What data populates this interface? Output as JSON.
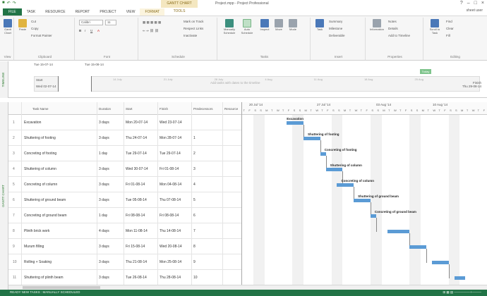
{
  "window": {
    "qat_icons": [
      "save-icon",
      "undo-icon",
      "redo-icon"
    ],
    "context_tab": "GANTT CHART TOOLS",
    "title": "Project.mpp - Project Professional",
    "user": "sheet user",
    "controls": [
      "?",
      "–",
      "□",
      "×"
    ]
  },
  "tabs": [
    {
      "label": "FILE"
    },
    {
      "label": "TASK"
    },
    {
      "label": "RESOURCE"
    },
    {
      "label": "REPORT"
    },
    {
      "label": "PROJECT"
    },
    {
      "label": "VIEW"
    },
    {
      "label": "FORMAT"
    }
  ],
  "ribbon": {
    "view_group": {
      "label": "View",
      "btn": "Gantt Chart"
    },
    "clipboard": {
      "label": "Clipboard",
      "paste": "Paste",
      "cut": "Cut",
      "copy": "Copy",
      "format_painter": "Format Painter"
    },
    "font": {
      "label": "Font",
      "name": "Calibri",
      "size": "11"
    },
    "schedule": {
      "label": "Schedule",
      "mark": "Mark on Track",
      "respect": "Respect Links",
      "inactivate": "Inactivate"
    },
    "tasks": {
      "label": "Tasks",
      "manually": "Manually Schedule",
      "auto": "Auto Schedule",
      "inspect": "Inspect",
      "move": "Move",
      "mode": "Mode"
    },
    "insert": {
      "label": "Insert",
      "task": "Task",
      "summary": "Summary",
      "milestone": "Milestone",
      "deliverable": "Deliverable"
    },
    "properties": {
      "label": "Properties",
      "information": "Information",
      "notes": "Notes",
      "details": "Details",
      "add_timeline": "Add to Timeline"
    },
    "editing": {
      "label": "Editing",
      "scroll": "Scroll to Task",
      "find": "Find",
      "clear": "Clear",
      "fill": "Fill"
    }
  },
  "timeline": {
    "side_label": "TIMELINE",
    "start": "Tue 15-07-14",
    "mid": "Tue 15-08-14",
    "start_label": "Start",
    "start_date": "Wed 02-07-14",
    "hint": "Add tasks with dates to the timeline",
    "today": "Today",
    "finish_label": "Finish",
    "finish_date": "Thu 29-08-14",
    "ticks": [
      "14 July",
      "21 July",
      "28 July",
      "4 Aug",
      "11 Aug",
      "18 Aug",
      "25 Aug"
    ]
  },
  "grid": {
    "side_label": "GANTT CHART",
    "headers": {
      "name": "Task Name",
      "duration": "Duration",
      "start": "Start",
      "finish": "Finish",
      "predecessors": "Predecessors",
      "resources": "Resource"
    },
    "rows": [
      {
        "id": "1",
        "name": "Excavation",
        "duration": "3 days",
        "start": "Mon 20-07-14",
        "finish": "Wed 23-07-14",
        "pred": ""
      },
      {
        "id": "2",
        "name": "Shuttering of footing",
        "duration": "3 days",
        "start": "Thu 24-07-14",
        "finish": "Mon 28-07-14",
        "pred": "1"
      },
      {
        "id": "3",
        "name": "Concreting of footing",
        "duration": "1 day",
        "start": "Tue 29-07-14",
        "finish": "Tue 29-07-14",
        "pred": "2"
      },
      {
        "id": "4",
        "name": "Shuttering of column",
        "duration": "3 days",
        "start": "Wed 30-07-14",
        "finish": "Fri 01-08-14",
        "pred": "3"
      },
      {
        "id": "5",
        "name": "Concreting of column",
        "duration": "3 days",
        "start": "Fri 01-08-14",
        "finish": "Mon 04-08-14",
        "pred": "4"
      },
      {
        "id": "6",
        "name": "Shuttering of ground beam",
        "duration": "3 days",
        "start": "Tue 05-08-14",
        "finish": "Thu 07-08-14",
        "pred": "5"
      },
      {
        "id": "7",
        "name": "Concreting of ground beam",
        "duration": "1 day",
        "start": "Fri 08-08-14",
        "finish": "Fri 08-08-14",
        "pred": "6"
      },
      {
        "id": "8",
        "name": "Plinth brick work",
        "duration": "4 days",
        "start": "Mon 11-08-14",
        "finish": "Thu 14-08-14",
        "pred": "7"
      },
      {
        "id": "9",
        "name": "Murum filling",
        "duration": "3 days",
        "start": "Fri 15-08-14",
        "finish": "Wed 20-08-14",
        "pred": "8"
      },
      {
        "id": "10",
        "name": "Rolling + Soaking",
        "duration": "3 days",
        "start": "Thu 21-08-14",
        "finish": "Mon 25-08-14",
        "pred": "9"
      },
      {
        "id": "11",
        "name": "Shuttering of plinth beam",
        "duration": "3 days",
        "start": "Tue 26-08-14",
        "finish": "Thu 28-08-14",
        "pred": "10"
      }
    ]
  },
  "chart": {
    "weeks": [
      "20 Jul '14",
      "27 Jul '14",
      "03 Aug '14",
      "10 Aug '14"
    ],
    "day_letters": [
      "T",
      "F",
      "S",
      "S",
      "M",
      "T",
      "W",
      "T",
      "F",
      "S",
      "S",
      "M",
      "T",
      "W",
      "T",
      "F",
      "S",
      "S",
      "M",
      "T",
      "W",
      "T",
      "F",
      "S",
      "S",
      "M",
      "T",
      "W",
      "T",
      "F",
      "S",
      "S",
      "M",
      "T",
      "W",
      "T",
      "F",
      "S",
      "S",
      "M",
      "T",
      "W",
      "T",
      "F"
    ],
    "bar_color": "#5b9bd5",
    "bars": [
      {
        "label": "Excavation",
        "start": 8,
        "len": 3
      },
      {
        "label": "Shuttering of footing",
        "start": 11,
        "len": 3
      },
      {
        "label": "Concreting of footing",
        "start": 14,
        "len": 1
      },
      {
        "label": "Shuttering of column",
        "start": 15,
        "len": 3
      },
      {
        "label": "Concreting of column",
        "start": 17,
        "len": 3
      },
      {
        "label": "Shuttering of ground beam",
        "start": 20,
        "len": 3
      },
      {
        "label": "Concreting of ground beam",
        "start": 23,
        "len": 1
      },
      {
        "label": "",
        "start": 26,
        "len": 4
      },
      {
        "label": "",
        "start": 30,
        "len": 3
      },
      {
        "label": "",
        "start": 34,
        "len": 3
      },
      {
        "label": "",
        "start": 38,
        "len": 2
      }
    ]
  },
  "status": {
    "left": "READY   NEW TASKS : MANUALLY SCHEDULED",
    "right": "⊞  ▦  ▤  —————+———"
  }
}
